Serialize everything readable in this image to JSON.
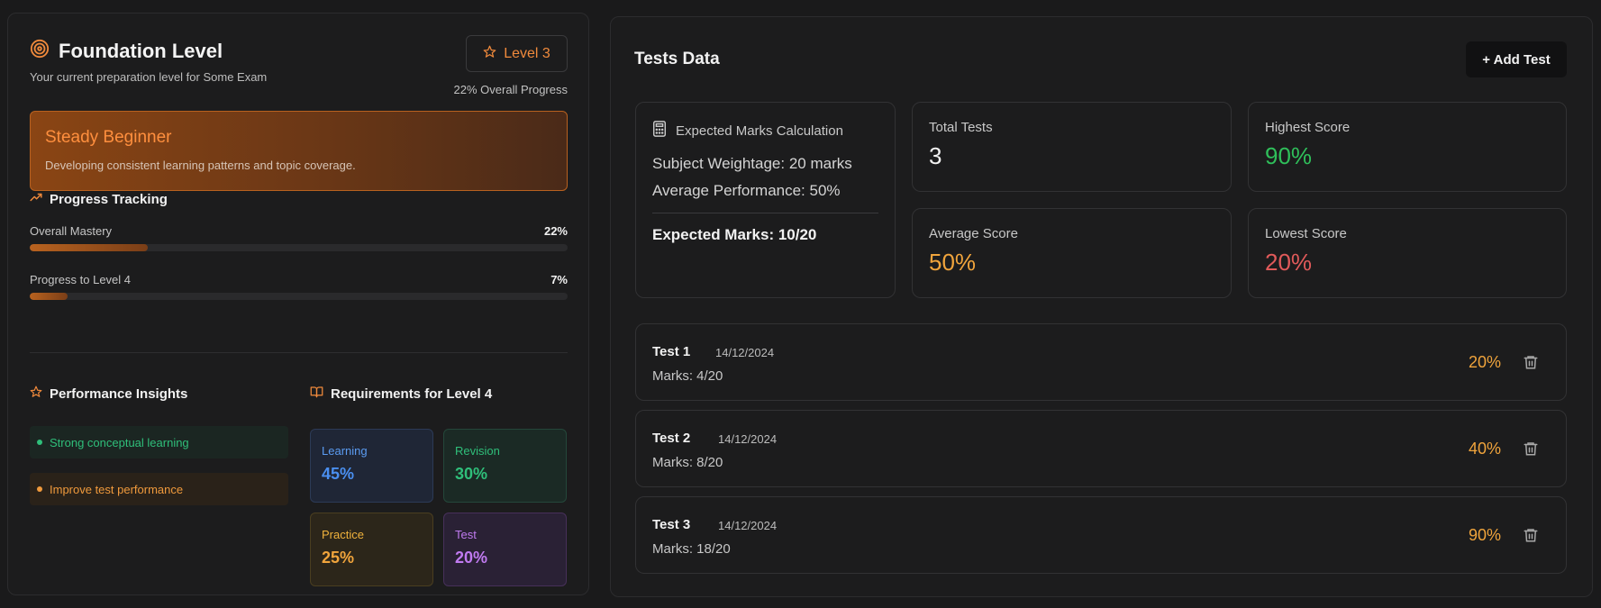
{
  "left": {
    "title": "Foundation Level",
    "subtitle": "Your current preparation level for Some Exam",
    "level_badge": "Level 3",
    "overall_progress": "22% Overall Progress",
    "hero": {
      "title": "Steady Beginner",
      "description": "Developing consistent learning patterns and topic coverage."
    },
    "progress_tracking": {
      "heading": "Progress Tracking",
      "bars": [
        {
          "label": "Overall Mastery",
          "value_text": "22%",
          "fraction": 0.22
        },
        {
          "label": "Progress to Level 4",
          "value_text": "7%",
          "fraction": 0.07
        }
      ]
    },
    "insights": {
      "heading": "Performance Insights",
      "items": [
        {
          "text": "Strong conceptual learning",
          "tone": "positive"
        },
        {
          "text": "Improve test performance",
          "tone": "warning"
        }
      ]
    },
    "requirements": {
      "heading": "Requirements for Level 4",
      "items": [
        {
          "label": "Learning",
          "value": "45%"
        },
        {
          "label": "Revision",
          "value": "30%"
        },
        {
          "label": "Practice",
          "value": "25%"
        },
        {
          "label": "Test",
          "value": "20%"
        }
      ]
    }
  },
  "right": {
    "title": "Tests Data",
    "add_button": "+ Add Test",
    "calculation": {
      "heading": "Expected Marks Calculation",
      "weightage": "Subject Weightage: 20 marks",
      "average": "Average Performance: 50%",
      "expected": "Expected Marks: 10/20"
    },
    "metrics": {
      "total": {
        "label": "Total Tests",
        "value": "3"
      },
      "highest": {
        "label": "Highest Score",
        "value": "90%"
      },
      "average": {
        "label": "Average Score",
        "value": "50%"
      },
      "lowest": {
        "label": "Lowest Score",
        "value": "20%"
      }
    },
    "tests": [
      {
        "name": "Test 1",
        "date": "14/12/2024",
        "marks": "Marks: 4/20",
        "score": "20%"
      },
      {
        "name": "Test 2",
        "date": "14/12/2024",
        "marks": "Marks: 8/20",
        "score": "40%"
      },
      {
        "name": "Test 3",
        "date": "14/12/2024",
        "marks": "Marks: 18/20",
        "score": "90%"
      }
    ]
  },
  "colors": {
    "accent_orange": "#f08a3c",
    "positive_green": "#2fbf7a",
    "negative_red": "#e05a5a",
    "background": "#1a1a1b"
  },
  "icons": {
    "title": "target-icon",
    "level": "star-icon",
    "progress": "trending-up-icon",
    "insights": "star-icon",
    "requirements": "book-open-icon",
    "calculation": "calculator-icon",
    "delete": "trash-icon"
  }
}
